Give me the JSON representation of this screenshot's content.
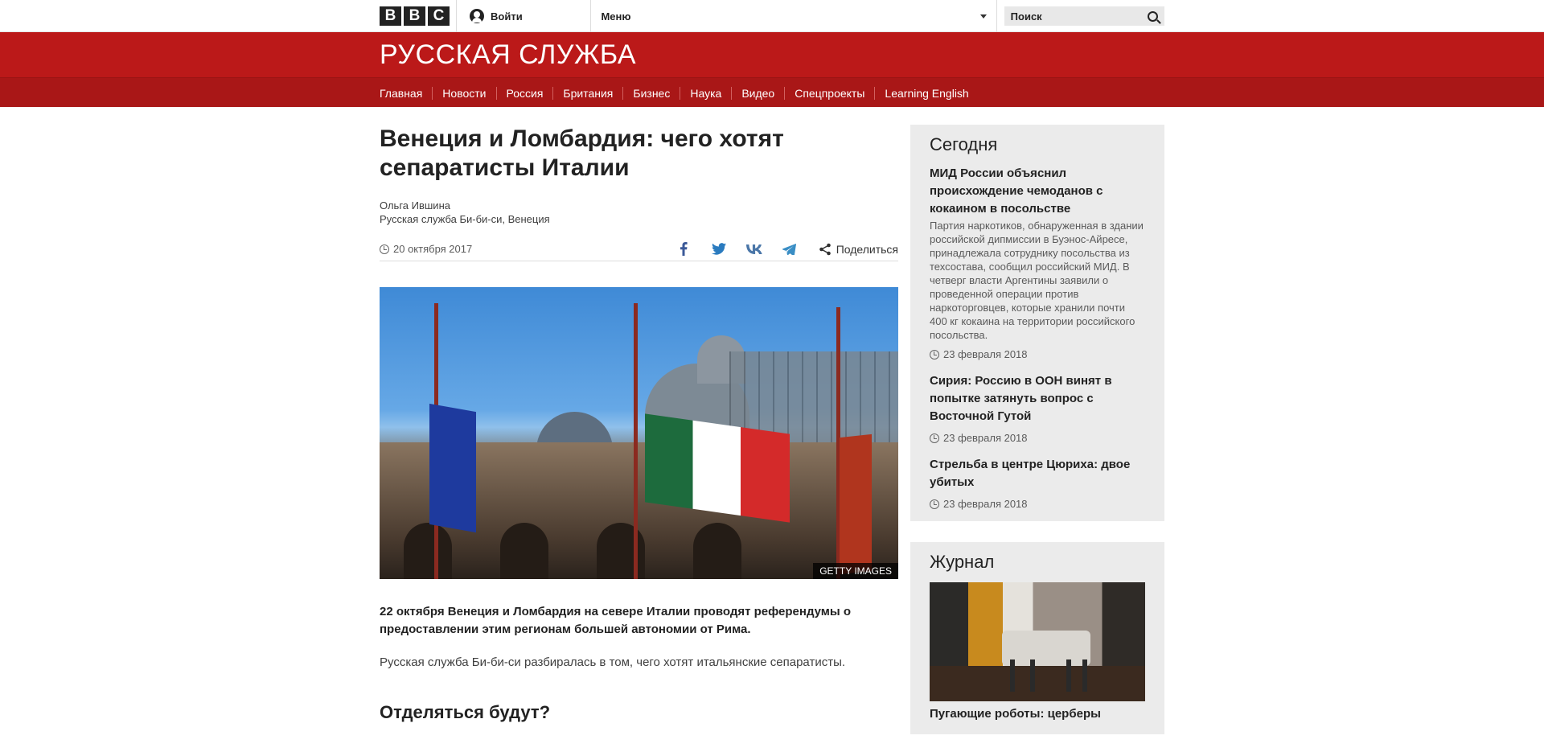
{
  "topbar": {
    "logo_letters": [
      "B",
      "B",
      "C"
    ],
    "signin_label": "Войти",
    "menu_label": "Меню",
    "search_placeholder": "Поиск"
  },
  "brand": {
    "title": "РУССКАЯ СЛУЖБА"
  },
  "nav": {
    "items": [
      "Главная",
      "Новости",
      "Россия",
      "Британия",
      "Бизнес",
      "Наука",
      "Видео",
      "Спецпроекты",
      "Learning English"
    ]
  },
  "article": {
    "headline": "Венеция и Ломбардия: чего хотят сепаратисты Италии",
    "author": "Ольга Ившина",
    "author_org": "Русская служба Би-би-си, Венеция",
    "date": "20 октября 2017",
    "share_label": "Поделиться",
    "share_icons": [
      "facebook-icon",
      "twitter-icon",
      "vk-icon",
      "telegram-icon"
    ],
    "image_credit": "GETTY IMAGES",
    "intro": "22 октября Венеция и Ломбардия на севере Италии проводят референдумы о предоставлении этим регионам большей автономии от Рима.",
    "paragraph": "Русская служба Би-би-си разбиралась в том, чего хотят итальянские сепаратисты.",
    "subhead": "Отделяться будут?"
  },
  "sidebar": {
    "today_title": "Сегодня",
    "stories": [
      {
        "title": "МИД России объяснил происхождение чемоданов с кокаином в посольстве",
        "summary": "Партия наркотиков, обнаруженная в здании российской дипмиссии в Буэнос-Айресе, принадлежала сотруднику посольства из техсостава, сообщил российский МИД. В четверг власти Аргентины заявили о проведенной операции против наркоторговцев, которые хранили почти 400 кг кокаина на территории российского посольства.",
        "date": "23 февраля 2018"
      },
      {
        "title": "Сирия: Россию в ООН винят в попытке затянуть вопрос с Восточной Гутой",
        "summary": "",
        "date": "23 февраля 2018"
      },
      {
        "title": "Стрельба в центре Цюриха: двое убитых",
        "summary": "",
        "date": "23 февраля 2018"
      }
    ],
    "journal_title": "Журнал",
    "journal_story_title": "Пугающие роботы: церберы"
  },
  "colors": {
    "brand_red": "#bb1919",
    "nav_red": "#a91717",
    "sidebar_bg": "#ebebeb"
  }
}
